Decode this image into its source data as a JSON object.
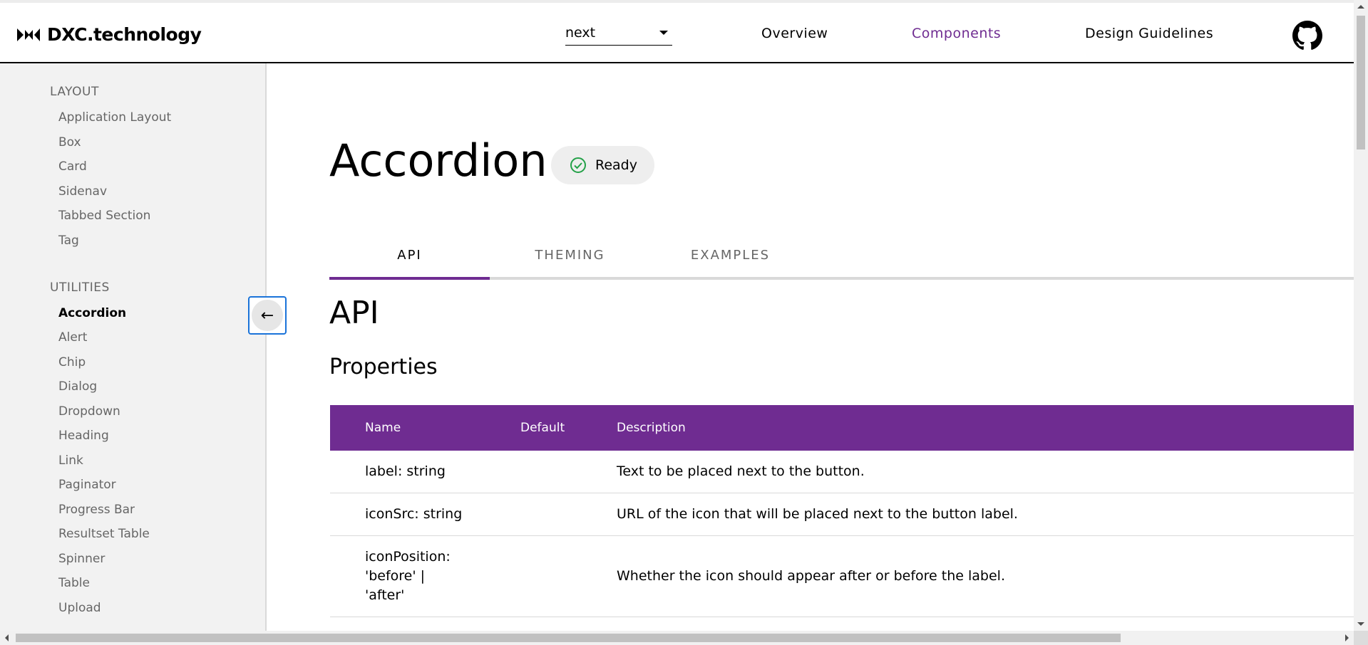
{
  "header": {
    "logo_text": "DXC.technology",
    "version": "next",
    "nav": [
      {
        "label": "Overview"
      },
      {
        "label": "Components"
      },
      {
        "label": "Design Guidelines"
      }
    ],
    "active_nav_color": "#6f2c91"
  },
  "sidebar": {
    "sections": [
      {
        "title": "LAYOUT",
        "items": [
          "Application Layout",
          "Box",
          "Card",
          "Sidenav",
          "Tabbed Section",
          "Tag"
        ]
      },
      {
        "title": "UTILITIES",
        "items": [
          "Accordion",
          "Alert",
          "Chip",
          "Dialog",
          "Dropdown",
          "Heading",
          "Link",
          "Paginator",
          "Progress Bar",
          "Resultset Table",
          "Spinner",
          "Table",
          "Upload"
        ]
      }
    ],
    "active_item": "Accordion",
    "collapse_icon": "arrow-left-icon"
  },
  "main": {
    "title": "Accordion",
    "status": "Ready",
    "status_color": "#24a148",
    "tabs": [
      "API",
      "THEMING",
      "EXAMPLES"
    ],
    "active_tab": "API",
    "section_heading": "API",
    "subheading": "Properties",
    "table": {
      "columns": [
        "Name",
        "Default",
        "Description"
      ],
      "rows": [
        {
          "name": "label: string",
          "default": "",
          "description": "Text to be placed next to the button."
        },
        {
          "name": "iconSrc: string",
          "default": "",
          "description": "URL of the icon that will be placed next to the button label."
        },
        {
          "name_lines": [
            "iconPosition:",
            "'before' |",
            "'after'"
          ],
          "default": "",
          "description": "Whether the icon should appear after or before the label."
        }
      ]
    },
    "accent_color": "#6f2c91"
  }
}
